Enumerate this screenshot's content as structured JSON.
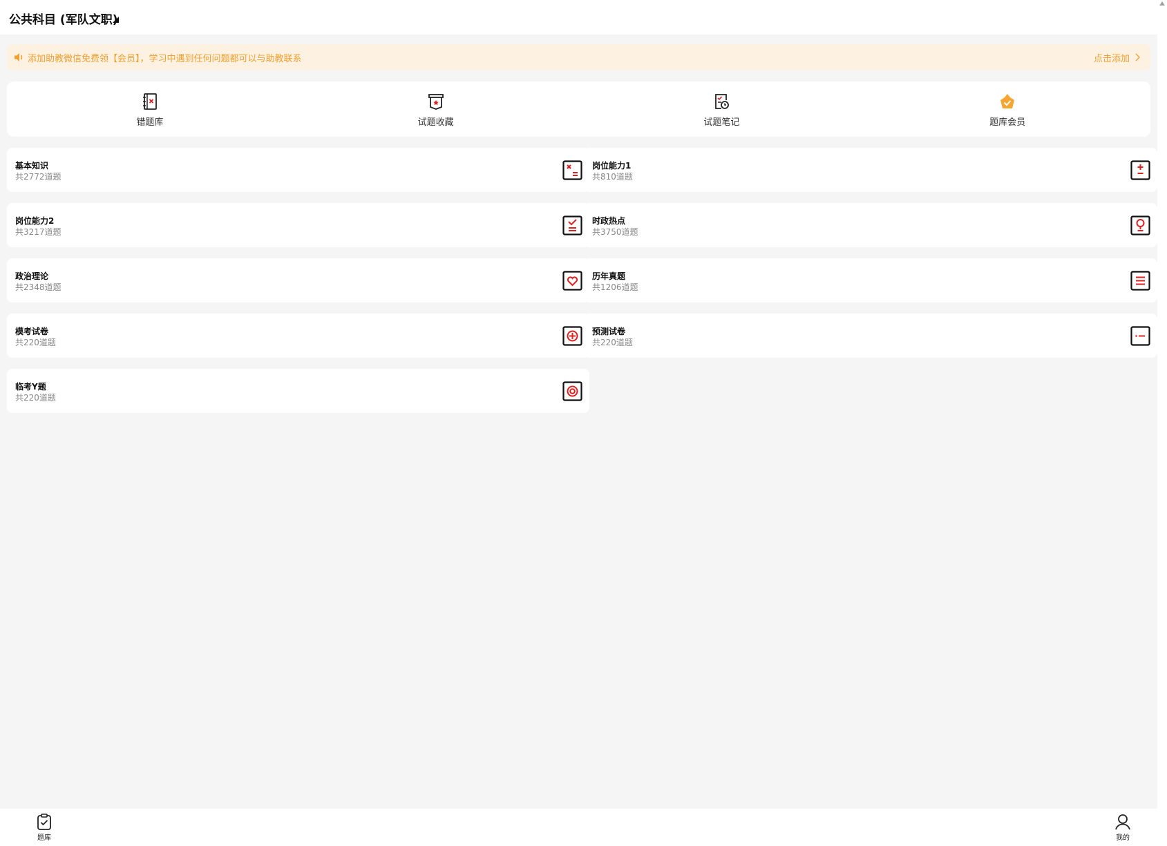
{
  "header": {
    "title": "公共科目 (军队文职)"
  },
  "notice": {
    "text": "添加助教微信免费领【会员】，学习中遇到任何问题都可以与助教联系",
    "action": "点击添加",
    "color": "#f0a030",
    "background": "#fdf1e1"
  },
  "quick_actions": [
    {
      "label": "错题库",
      "icon": "notebook-x-icon"
    },
    {
      "label": "试题收藏",
      "icon": "bookmark-star-icon"
    },
    {
      "label": "试题笔记",
      "icon": "note-clock-icon"
    },
    {
      "label": "题库会员",
      "icon": "crown-icon"
    }
  ],
  "categories": [
    {
      "title": "基本知识",
      "count": "共2772道题",
      "icon": "calc-x-icon"
    },
    {
      "title": "岗位能力1",
      "count": "共810道题",
      "icon": "plus-minus-icon"
    },
    {
      "title": "岗位能力2",
      "count": "共3217道题",
      "icon": "check-list-icon"
    },
    {
      "title": "时政热点",
      "count": "共3750道题",
      "icon": "bulb-icon"
    },
    {
      "title": "政治理论",
      "count": "共2348道题",
      "icon": "heart-icon"
    },
    {
      "title": "历年真题",
      "count": "共1206道题",
      "icon": "list-icon"
    },
    {
      "title": "模考试卷",
      "count": "共220道题",
      "icon": "circle-plus-icon"
    },
    {
      "title": "预测试卷",
      "count": "共220道题",
      "icon": "dot-minus-icon"
    },
    {
      "title": "临考Y题",
      "count": "共220道题",
      "icon": "target-icon"
    }
  ],
  "tabbar": {
    "left": {
      "label": "题库",
      "icon": "clipboard-check-icon"
    },
    "right": {
      "label": "我的",
      "icon": "user-icon"
    }
  },
  "colors": {
    "accent_red": "#e02020",
    "orange": "#f7a531"
  }
}
